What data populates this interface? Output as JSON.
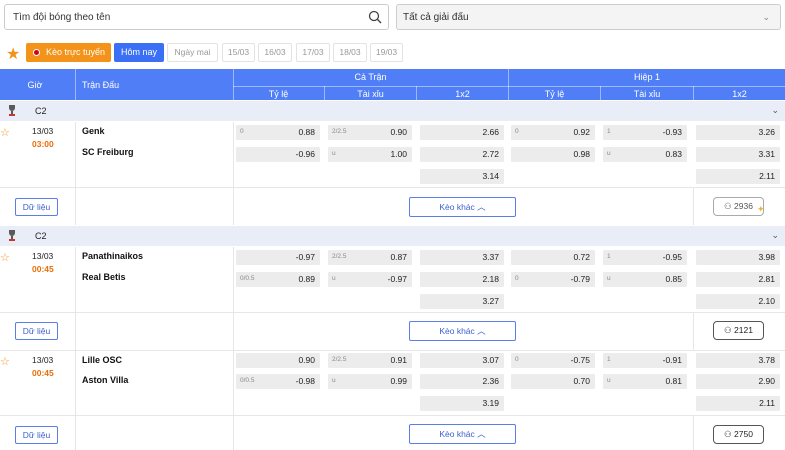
{
  "search": {
    "placeholder": "Tìm đội bóng theo tên"
  },
  "league_filter": {
    "selected": "Tất cả giải đấu"
  },
  "datebar": {
    "live_label": "Kèo trực tuyến",
    "today_label": "Hôm nay",
    "dates": [
      "Ngày mai",
      "15/03",
      "16/03",
      "17/03",
      "18/03",
      "19/03"
    ]
  },
  "table_header": {
    "time": "Giờ",
    "match": "Trận Đấu",
    "full_match": "Cả Trận",
    "first_half": "Hiệp 1",
    "handicap": "Tỷ lệ",
    "over_under": "Tài xỉu",
    "x12": "1x2"
  },
  "leagues": [
    {
      "name": "C2"
    },
    {
      "name": "C2"
    }
  ],
  "matches": [
    {
      "date": "13/03",
      "time": "03:00",
      "home": "Genk",
      "away": "SC Freiburg",
      "ft_hdp": [
        {
          "h": "0",
          "v": "0.88"
        },
        {
          "h": "",
          "v": "-0.96"
        }
      ],
      "ft_ou": [
        {
          "h": "2/2.5",
          "v": "0.90"
        },
        {
          "h": "u",
          "v": "1.00"
        }
      ],
      "ft_1x2": [
        "2.66",
        "2.72",
        "3.14"
      ],
      "h1_hdp": [
        {
          "h": "0",
          "v": "0.92"
        },
        {
          "h": "",
          "v": "0.98"
        }
      ],
      "h1_ou": [
        {
          "h": "1",
          "v": "-0.93"
        },
        {
          "h": "u",
          "v": "0.83"
        }
      ],
      "h1_1x2": [
        "3.26",
        "3.31",
        "2.11"
      ],
      "data_label": "Dữ liệu",
      "more_label": "Kèo khác",
      "viewers": "2936"
    },
    {
      "date": "13/03",
      "time": "00:45",
      "home": "Panathinaikos",
      "away": "Real Betis",
      "ft_hdp": [
        {
          "h": "",
          "v": "-0.97"
        },
        {
          "h": "0/0.5",
          "v": "0.89"
        }
      ],
      "ft_ou": [
        {
          "h": "2/2.5",
          "v": "0.87"
        },
        {
          "h": "u",
          "v": "-0.97"
        }
      ],
      "ft_1x2": [
        "3.37",
        "2.18",
        "3.27"
      ],
      "h1_hdp": [
        {
          "h": "",
          "v": "0.72"
        },
        {
          "h": "0",
          "v": "-0.79"
        }
      ],
      "h1_ou": [
        {
          "h": "1",
          "v": "-0.95"
        },
        {
          "h": "u",
          "v": "0.85"
        }
      ],
      "h1_1x2": [
        "3.98",
        "2.81",
        "2.10"
      ],
      "data_label": "Dữ liệu",
      "more_label": "Kèo khác",
      "viewers": "2121"
    },
    {
      "date": "13/03",
      "time": "00:45",
      "home": "Lille OSC",
      "away": "Aston Villa",
      "ft_hdp": [
        {
          "h": "",
          "v": "0.90"
        },
        {
          "h": "0/0.5",
          "v": "-0.98"
        }
      ],
      "ft_ou": [
        {
          "h": "2/2.5",
          "v": "0.91"
        },
        {
          "h": "u",
          "v": "0.99"
        }
      ],
      "ft_1x2": [
        "3.07",
        "2.36",
        "3.19"
      ],
      "h1_hdp": [
        {
          "h": "0",
          "v": "-0.75"
        },
        {
          "h": "",
          "v": "0.70"
        }
      ],
      "h1_ou": [
        {
          "h": "1",
          "v": "-0.91"
        },
        {
          "h": "u",
          "v": "0.81"
        }
      ],
      "h1_1x2": [
        "3.78",
        "2.90",
        "2.11"
      ],
      "data_label": "Dữ liệu",
      "more_label": "Kèo khác",
      "viewers": "2750"
    }
  ],
  "icons": {
    "search": "search-icon",
    "favorite": "star-icon",
    "cup": "trophy-icon",
    "collapse": "chevron-down-icon",
    "expand_more": "chevron-up-icon",
    "viewers": "user-icon"
  },
  "colors": {
    "accent": "#4f7ef7",
    "live": "#f39319",
    "time": "#e86f0a"
  }
}
